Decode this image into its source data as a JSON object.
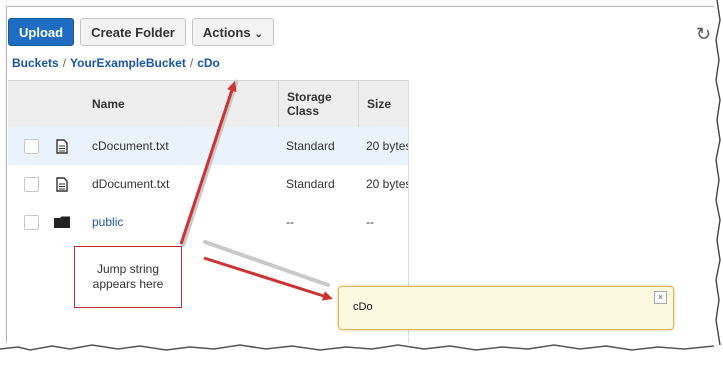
{
  "toolbar": {
    "upload_label": "Upload",
    "create_folder_label": "Create Folder",
    "actions_label": "Actions",
    "caret": "⌄",
    "refresh_icon": "↻"
  },
  "breadcrumb": {
    "items": [
      "Buckets",
      "YourExampleBucket",
      "cDo"
    ],
    "separator": "/"
  },
  "table": {
    "headers": {
      "name": "Name",
      "storage_class": "Storage Class",
      "size": "Size"
    },
    "rows": [
      {
        "name": "cDocument.txt",
        "type": "file",
        "storage_class": "Standard",
        "size": "20 bytes"
      },
      {
        "name": "dDocument.txt",
        "type": "file",
        "storage_class": "Standard",
        "size": "20 bytes"
      },
      {
        "name": "public",
        "type": "folder",
        "storage_class": "--",
        "size": "--"
      }
    ]
  },
  "callout": {
    "text": "Jump string appears here"
  },
  "jump_box": {
    "text": "cDo",
    "close_icon": "×"
  },
  "colors": {
    "accent": "#1f6dc2",
    "arrow": "#cc3333",
    "jump_bg": "#fbfae0"
  }
}
